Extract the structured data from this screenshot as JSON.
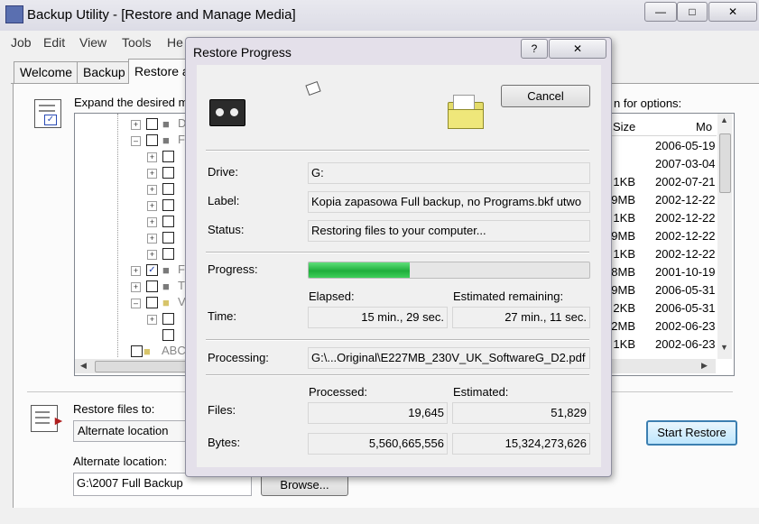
{
  "app": {
    "title": "Backup Utility - [Restore and Manage Media]",
    "menus": [
      "Job",
      "Edit",
      "View",
      "Tools",
      "He"
    ],
    "tabs": [
      "Welcome",
      "Backup",
      "Restore a"
    ]
  },
  "panel": {
    "instructions": "Expand the desired m",
    "options_hint": "n for options:",
    "tree_labels": [
      "D",
      "F",
      "F",
      "T",
      "V",
      "ABC"
    ],
    "list_headers": {
      "size": "Size",
      "modified": "Mo"
    },
    "list_rows": [
      {
        "size": "",
        "modified": "2006-05-19"
      },
      {
        "size": "",
        "modified": "2007-03-04"
      },
      {
        "size": "1KB",
        "modified": "2002-07-21"
      },
      {
        "size": "9MB",
        "modified": "2002-12-22"
      },
      {
        "size": "1KB",
        "modified": "2002-12-22"
      },
      {
        "size": "9MB",
        "modified": "2002-12-22"
      },
      {
        "size": "1KB",
        "modified": "2002-12-22"
      },
      {
        "size": "8MB",
        "modified": "2001-10-19"
      },
      {
        "size": "9MB",
        "modified": "2006-05-31"
      },
      {
        "size": "2KB",
        "modified": "2006-05-31"
      },
      {
        "size": "2MB",
        "modified": "2002-06-23"
      },
      {
        "size": "1KB",
        "modified": "2002-06-23"
      }
    ],
    "restore_to_label": "Restore files to:",
    "restore_to_value": "Alternate location",
    "alt_location_label": "Alternate location:",
    "alt_location_value": "G:\\2007 Full Backup",
    "browse_label": "Browse...",
    "start_restore_label": "Start Restore"
  },
  "dialog": {
    "title": "Restore Progress",
    "help_glyph": "?",
    "cancel_label": "Cancel",
    "drive_label": "Drive:",
    "drive_value": "G:",
    "label_label": "Label:",
    "label_value": "Kopia zapasowa Full backup, no Programs.bkf utwo",
    "status_label": "Status:",
    "status_value": "Restoring files to your computer...",
    "progress_label": "Progress:",
    "progress_fraction": 0.36,
    "elapsed_label": "Elapsed:",
    "remaining_label": "Estimated remaining:",
    "time_label": "Time:",
    "elapsed_value": "15 min., 29 sec.",
    "remaining_value": "27 min., 11 sec.",
    "processing_label": "Processing:",
    "processing_value": "G:\\...Original\\E227MB_230V_UK_SoftwareG_D2.pdf",
    "processed_label": "Processed:",
    "estimated_label": "Estimated:",
    "files_label": "Files:",
    "files_processed": "19,645",
    "files_estimated": "51,829",
    "bytes_label": "Bytes:",
    "bytes_processed": "5,560,665,556",
    "bytes_estimated": "15,324,273,626"
  },
  "colors": {
    "progress_fill": "#2ec24a",
    "accent": "#3c7fb1"
  }
}
